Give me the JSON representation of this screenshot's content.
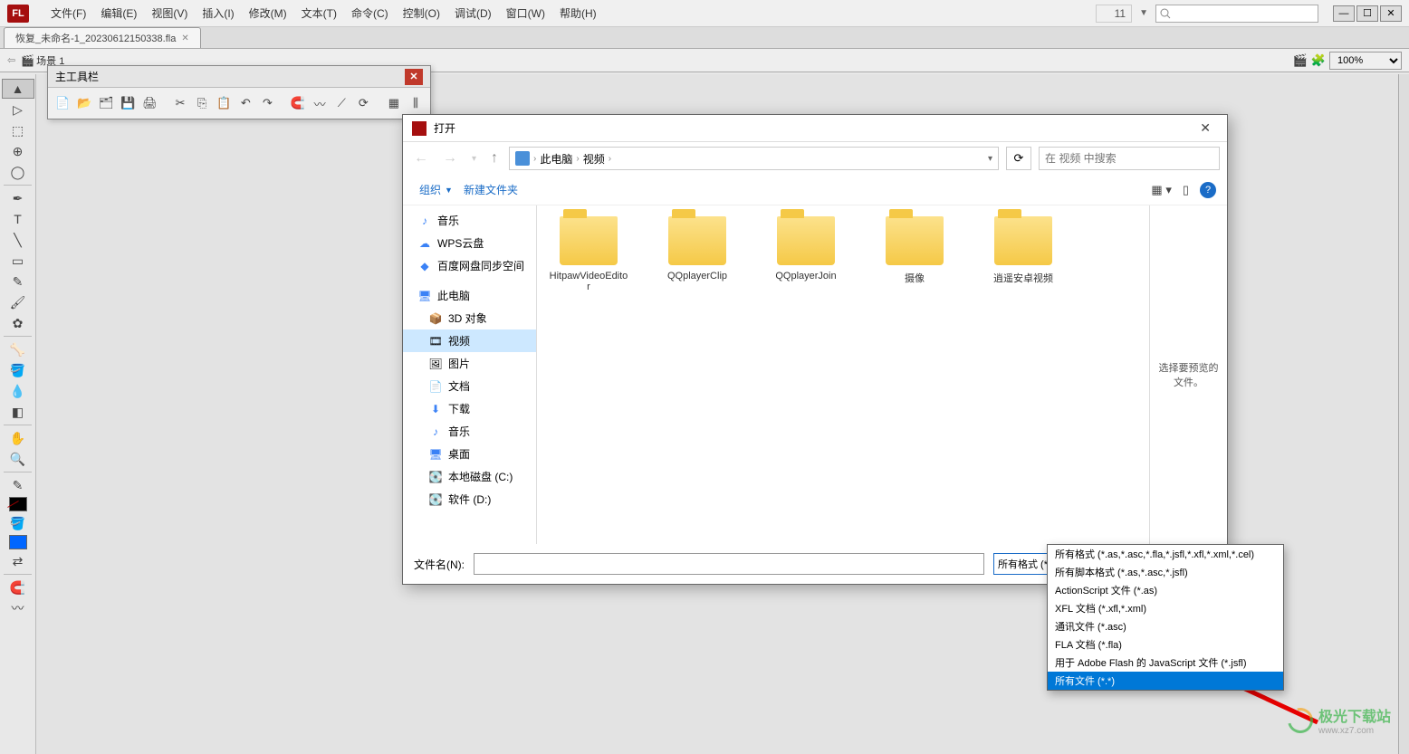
{
  "app": {
    "logo": "FL"
  },
  "menubar": {
    "items": [
      "文件(F)",
      "编辑(E)",
      "视图(V)",
      "插入(I)",
      "修改(M)",
      "文本(T)",
      "命令(C)",
      "控制(O)",
      "调试(D)",
      "窗口(W)",
      "帮助(H)"
    ],
    "layout_number": "11",
    "search_placeholder": ""
  },
  "doc_tab": {
    "title": "恢复_未命名-1_20230612150338.fla"
  },
  "scene": {
    "icon": "🎬",
    "name": "场景 1",
    "zoom": "100%"
  },
  "float_panel": {
    "title": "主工具栏"
  },
  "dialog": {
    "title": "打开",
    "breadcrumb": {
      "root": "此电脑",
      "current": "视频"
    },
    "search_placeholder": "在 视频 中搜索",
    "organize": "组织",
    "new_folder": "新建文件夹",
    "sidebar": {
      "top": [
        {
          "icon": "🎵",
          "label": "音乐",
          "color": "#3b82f6"
        },
        {
          "icon": "☁",
          "label": "WPS云盘",
          "color": "#3b82f6"
        },
        {
          "icon": "◆",
          "label": "百度网盘同步空间",
          "color": "#3b82f6"
        }
      ],
      "pc_label": "此电脑",
      "pc_items": [
        {
          "icon": "📦",
          "label": "3D 对象"
        },
        {
          "icon": "🎞",
          "label": "视频",
          "selected": true
        },
        {
          "icon": "🖼",
          "label": "图片"
        },
        {
          "icon": "📄",
          "label": "文档"
        },
        {
          "icon": "⬇",
          "label": "下载"
        },
        {
          "icon": "🎵",
          "label": "音乐"
        },
        {
          "icon": "🖥",
          "label": "桌面"
        },
        {
          "icon": "💽",
          "label": "本地磁盘 (C:)"
        },
        {
          "icon": "💽",
          "label": "软件 (D:)"
        }
      ]
    },
    "folders": [
      "HitpawVideoEditor",
      "QQplayerClip",
      "QQplayerJoin",
      "摄像",
      "逍遥安卓视频"
    ],
    "preview_text": "选择要预览的文件。",
    "filename_label": "文件名(N):",
    "filetype_selected": "所有格式 (*.as,*.asc,*.fla,*.jsfl,*.xfl,*.xml,*.cel)",
    "filetype_options": [
      "所有格式 (*.as,*.asc,*.fla,*.jsfl,*.xfl,*.xml,*.cel)",
      "所有脚本格式 (*.as,*.asc,*.jsfl)",
      "ActionScript 文件 (*.as)",
      "XFL 文档 (*.xfl,*.xml)",
      "通讯文件 (*.asc)",
      "FLA 文档 (*.fla)",
      "用于 Adobe Flash 的 JavaScript 文件 (*.jsfl)",
      "所有文件 (*.*)"
    ]
  },
  "watermark": {
    "name": "极光下载站",
    "url": "www.xz7.com"
  }
}
